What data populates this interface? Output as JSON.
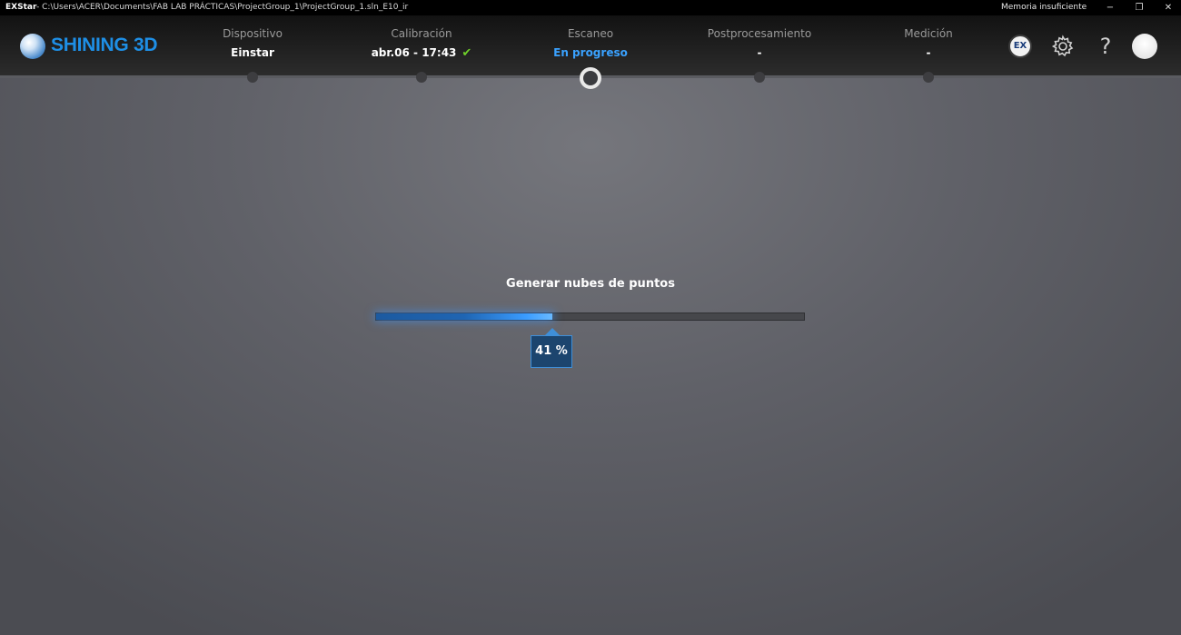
{
  "titlebar": {
    "app_name": "EXStar",
    "separator": "-",
    "path": "C:\\Users\\ACER\\Documents\\FAB LAB PRÁCTICAS\\ProjectGroup_1\\ProjectGroup_1.sln_E10_ir",
    "status": "Memoria insuficiente",
    "controls": {
      "minimize": "−",
      "restore": "❐",
      "close": "✕"
    }
  },
  "header": {
    "logo_text": "SHINING 3D",
    "steps": [
      {
        "label": "Dispositivo",
        "value": "Einstar"
      },
      {
        "label": "Calibración",
        "value": "abr.06 - 17:43",
        "check": "✔"
      },
      {
        "label": "Escaneo",
        "value": "En progreso"
      },
      {
        "label": "Postprocesamiento",
        "value": "-"
      },
      {
        "label": "Medición",
        "value": "-"
      }
    ],
    "current_step": 2,
    "icons": {
      "ex_badge": "EX",
      "settings": "gear-icon",
      "help_glyph": "?",
      "avatar": "avatar-icon"
    }
  },
  "progress": {
    "title": "Generar nubes de puntos",
    "percent": 41,
    "percent_text": "41 %",
    "accent_color": "#3aa2ff"
  }
}
